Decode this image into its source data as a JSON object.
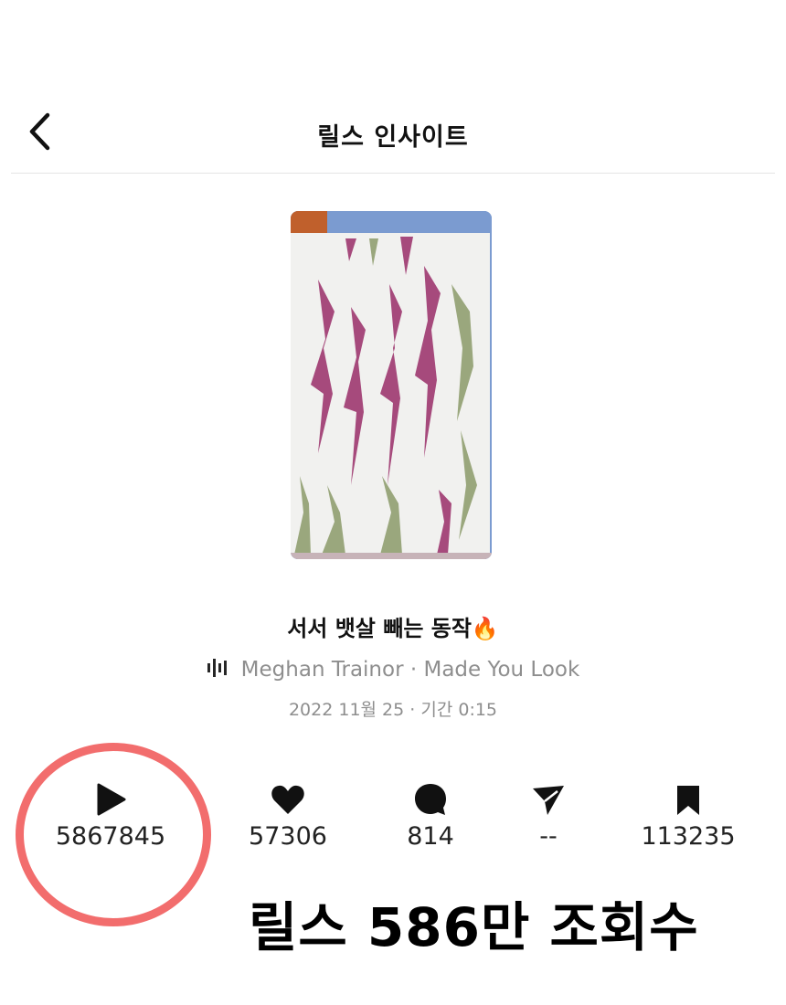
{
  "header": {
    "title": "릴스 인사이트",
    "back_icon": "chevron-left-icon"
  },
  "reel": {
    "thumbnail": "reel-thumbnail-image",
    "title": "서서 뱃살 빼는 동작🔥",
    "audio_icon": "audio-wave-icon",
    "audio": "Meghan Trainor · Made You Look",
    "meta": "2022 11월 25 · 기간 0:15"
  },
  "stats": [
    {
      "icon": "play-icon",
      "value": "5867845"
    },
    {
      "icon": "heart-icon",
      "value": "57306"
    },
    {
      "icon": "comment-icon",
      "value": "814"
    },
    {
      "icon": "share-icon",
      "value": "--"
    },
    {
      "icon": "bookmark-icon",
      "value": "113235"
    }
  ],
  "annotation": {
    "caption": "릴스 586만 조회수",
    "circle_color": "#f26d6d"
  }
}
